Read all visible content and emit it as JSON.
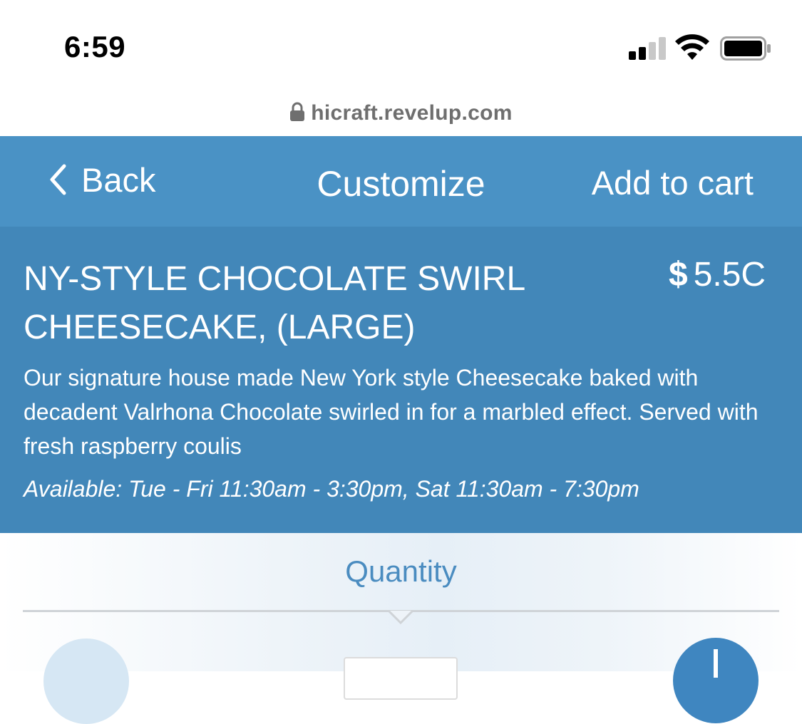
{
  "status_bar": {
    "time": "6:59",
    "icons": [
      "cellular-signal-icon",
      "wifi-icon",
      "battery-icon"
    ]
  },
  "url_bar": {
    "lock_icon": "lock-icon",
    "url": "hicraft.revelup.com"
  },
  "header": {
    "back_label": "Back",
    "title": "Customize",
    "add_to_cart_label": "Add to cart"
  },
  "product": {
    "name": "NY-STYLE CHOCOLATE SWIRL CHEESECAKE, (LARGE)",
    "currency": "$",
    "price": "5.5C",
    "description": "Our signature house made New York style Cheesecake baked with decadent Valrhona Chocolate swirled in for a marbled effect. Served with fresh raspberry coulis",
    "availability": "Available: Tue - Fri 11:30am - 3:30pm, Sat 11:30am - 7:30pm"
  },
  "quantity": {
    "title": "Quantity",
    "value": ""
  },
  "colors": {
    "header_bg": "#4a92c5",
    "product_bg": "#4287b9",
    "accent": "#4a8cc0"
  }
}
